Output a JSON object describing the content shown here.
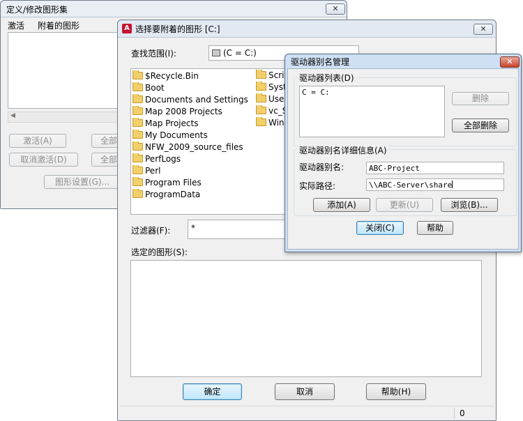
{
  "sheet_set_window": {
    "title": "定义/修改图形集",
    "col_activate": "激活",
    "col_attached": "附着的图形",
    "activate_btn": "激活(A)",
    "deactivate_btn": "取消激活(D)",
    "all_btn_1": "全部",
    "all_btn_2": "全部",
    "drawing_settings_btn": "图形设置(G)...",
    "close_glyph": "✕"
  },
  "select_dialog": {
    "title": "选择要附着的图形 [C:]",
    "look_in_label": "查找范围(I):",
    "look_in_value": "(C = C:)",
    "folders_col1": [
      "$Recycle.Bin",
      "Boot",
      "Documents and Settings",
      "Map 2008 Projects",
      "Map Projects",
      "My Documents",
      "NFW_2009_source_files",
      "PerfLogs",
      "Perl",
      "Program Files",
      "ProgramData"
    ],
    "folders_col2": [
      "Scrip",
      "Syst",
      "Use",
      "vc_S",
      "Wind"
    ],
    "filter_label": "过滤器(F):",
    "filter_value": "*",
    "selected_label": "选定的图形(S):",
    "ok_btn": "确定",
    "cancel_btn": "取消",
    "help_btn": "帮助(H)",
    "status_count": "0",
    "close_glyph": "✕"
  },
  "alias_dialog": {
    "title": "驱动器别名管理",
    "list_group_label": "驱动器列表(D)",
    "list_items": [
      "C = C:"
    ],
    "delete_btn": "删除",
    "delete_all_btn": "全部删除",
    "detail_group_label": "驱动器别名详细信息(A)",
    "alias_label": "驱动器别名:",
    "alias_value": "ABC-Project",
    "path_label": "实际路径:",
    "path_value": "\\\\ABC-Server\\share",
    "add_btn": "添加(A)",
    "update_btn": "更新(U)",
    "browse_btn": "浏览(B)...",
    "close_btn": "关闭(C)",
    "help_btn": "帮助",
    "close_glyph": "✕"
  }
}
